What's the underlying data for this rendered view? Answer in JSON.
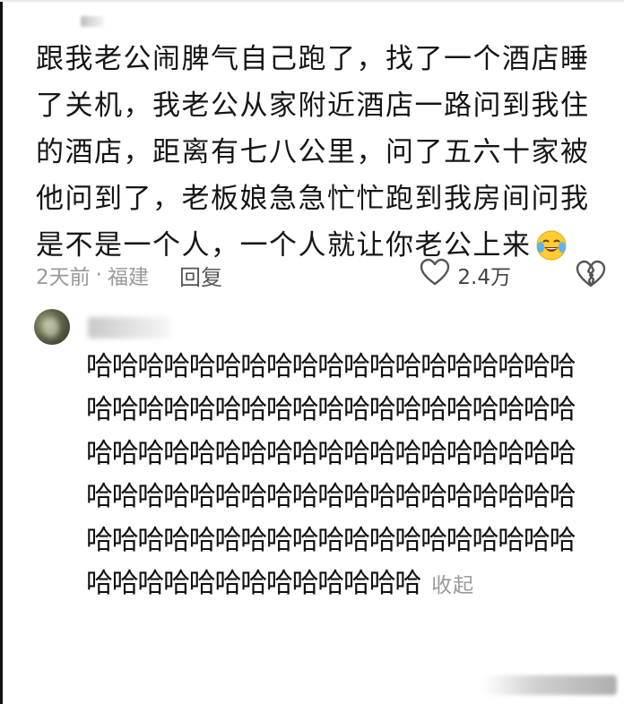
{
  "comment": {
    "text": "跟我老公闹脾气自己跑了，找了一个酒店睡了关机，我老公从家附近酒店一路问到我住的酒店，距离有七八公里，问了五六十家被他问到了，老板娘急急忙忙跑到我房间问我是不是一个人，一个人就让你老公上来",
    "emoji": "laughing-crying-emoji",
    "time": "2天前",
    "separator": "·",
    "location": "福建",
    "reply_label": "回复",
    "like_icon": "heart-outline-icon",
    "like_count": "2.4万",
    "dislike_icon": "broken-heart-icon"
  },
  "reply": {
    "text": "哈哈哈哈哈哈哈哈哈哈哈哈哈哈哈哈哈哈哈哈哈哈哈哈哈哈哈哈哈哈哈哈哈哈哈哈哈哈哈哈哈哈哈哈哈哈哈哈哈哈哈哈哈哈哈哈哈哈哈哈哈哈哈哈哈哈哈哈哈哈哈哈哈哈哈哈哈哈哈哈哈哈哈哈哈哈哈哈哈哈哈哈哈哈哈哈哈哈哈哈哈哈哈哈哈哈哈哈",
    "collapse_label": "收起"
  },
  "colors": {
    "text": "#111111",
    "muted": "#9a9a9a",
    "icon": "#555555"
  }
}
